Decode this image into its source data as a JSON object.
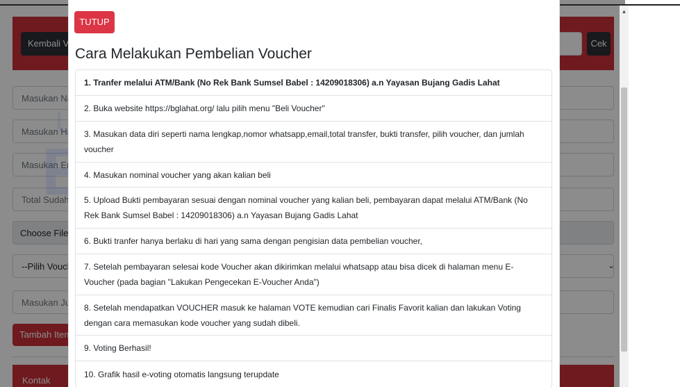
{
  "page": {
    "header": {
      "back_label": "Kembali Vo",
      "check_label": "Cek"
    },
    "form": {
      "name_placeholder": "Masukan Na",
      "phone_placeholder": "Masukan Ha",
      "email_placeholder": "Masukan Em",
      "total_placeholder": "Total Sudah",
      "file_label": "Choose File",
      "voucher_select": "--Pilih Vouch",
      "qty_placeholder": "Masukan Jur",
      "add_item_label": "Tambah Item"
    },
    "footer": {
      "contact_label": "Kontak"
    },
    "watermark": {
      "line1": "Universitas",
      "line2": "Esa Unggul"
    }
  },
  "modal": {
    "close_label": "TUTUP",
    "title": "Cara Melakukan Pembelian Voucher",
    "steps": [
      "1. Tranfer melalui ATM/Bank (No Rek Bank Sumsel Babel : 14209018306) a.n Yayasan Bujang Gadis Lahat",
      "2. Buka website https://bglahat.org/ lalu pilih menu \"Beli Voucher\"",
      "3. Masukan data diri seperti nama lengkap,nomor whatsapp,email,total transfer, bukti transfer, pilih voucher, dan jumlah voucher",
      "4. Masukan nominal voucher yang akan kalian beli",
      "5. Upload Bukti pembayaran sesuai dengan nominal voucher yang kalian beli, pembayaran dapat melalui ATM/Bank (No Rek Bank Sumsel Babel : 14209018306) a.n Yayasan Bujang Gadis Lahat",
      "6. Bukti tranfer hanya berlaku di hari yang sama dengan pengisian data pembelian voucher,",
      "7. Setelah pembayaran selesai kode Voucher akan dikirimkan melalui whatsapp atau bisa dicek di halaman menu E-Voucher (pada bagian \"Lakukan Pengecekan E-Voucher Anda\")",
      "8. Setelah mendapatkan VOUCHER masuk ke halaman VOTE kemudian cari Finalis Favorit kalian dan lakukan Voting dengan cara memasukan kode voucher yang sudah dibeli.",
      "9. Voting Berhasil!",
      "10. Grafik hasil e-voting otomatis langsung terupdate"
    ]
  },
  "colors": {
    "primary_red": "#c8303a",
    "danger_button": "#dc3545",
    "dark_button": "#2a2f35"
  }
}
